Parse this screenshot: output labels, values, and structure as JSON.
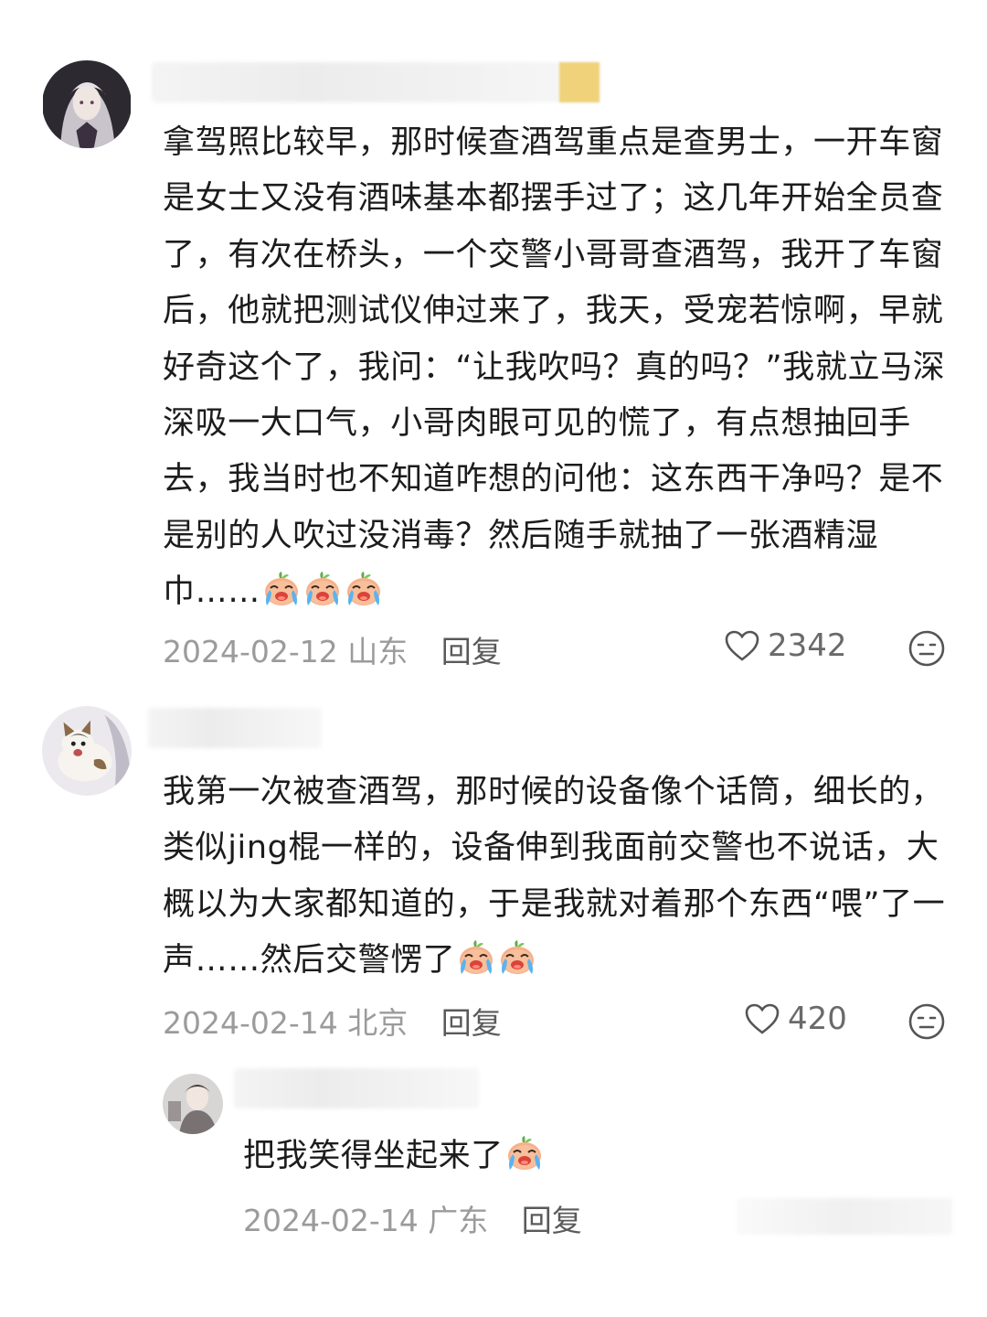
{
  "comments": [
    {
      "text": "拿驾照比较早，那时候查酒驾重点是查男士，一开车窗是女士又没有酒味基本都摆手过了；这几年开始全员查了，有次在桥头，一个交警小哥哥查酒驾，我开了车窗后，他就把测试仪伸过来了，我天，受宠若惊啊，早就好奇这个了，我问：“让我吹吗？真的吗？”我就立马深深吸一大口气，小哥肉眼可见的慌了，有点想抽回手去，我当时也不知道咋想的问他：这东西干净吗？是不是别的人吹过没消毒？然后随手就抽了一张酒精湿巾……",
      "emoji_count": 3,
      "date": "2024-02-12",
      "location": "山东",
      "reply_label": "回复",
      "likes": "2342",
      "avatar_icon": "anime-girl-avatar"
    },
    {
      "text": "我第一次被查酒驾，那时候的设备像个话筒，细长的，类似jing棍一样的，设备伸到我面前交警也不说话，大概以为大家都知道的，于是我就对着那个东西“喂”了一声……然后交警愣了",
      "emoji_count": 2,
      "date": "2024-02-14",
      "location": "北京",
      "reply_label": "回复",
      "likes": "420",
      "avatar_icon": "cat-avatar"
    }
  ],
  "reply": {
    "text": "把我笑得坐起来了",
    "emoji_count": 1,
    "date": "2024-02-14",
    "location": "广东",
    "reply_label": "回复",
    "avatar_icon": "person-avatar"
  }
}
